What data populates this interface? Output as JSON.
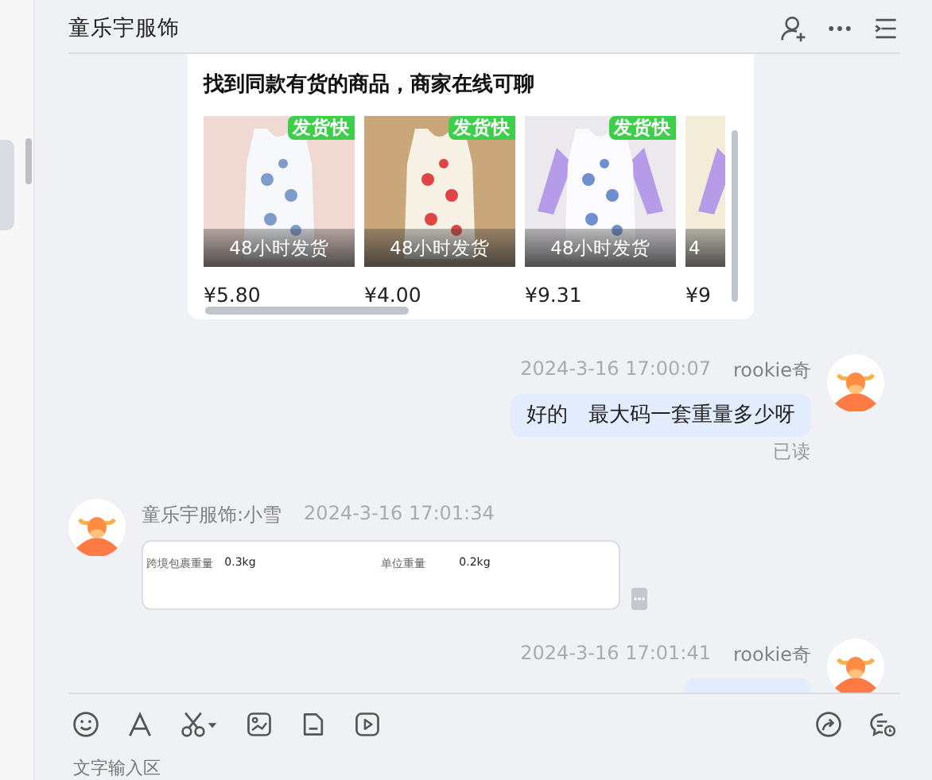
{
  "header": {
    "title": "童乐宇服饰"
  },
  "product_card": {
    "title": "找到同款有货的商品，商家在线可聊",
    "products": [
      {
        "badge": "发货快",
        "overlay": "48小时发货",
        "price": "¥5.80"
      },
      {
        "badge": "发货快",
        "overlay": "48小时发货",
        "price": "¥4.00"
      },
      {
        "badge": "发货快",
        "overlay": "48小时发货",
        "price": "¥9.31"
      },
      {
        "overlay": "4",
        "price": "¥9"
      }
    ]
  },
  "messages": [
    {
      "outgoing": true,
      "kind": "text",
      "time": "2024-3-16 17:00:07",
      "sender": "rookie奇",
      "text": "好的　最大码一套重量多少呀",
      "status": "已读"
    },
    {
      "outgoing": false,
      "kind": "table",
      "sender": "童乐宇服饰:小雪",
      "time": "2024-3-16 17:01:34",
      "cells": [
        "跨境包裹重量",
        "0.3kg",
        "单位重量",
        "0.2kg"
      ]
    },
    {
      "outgoing": true,
      "kind": "peek",
      "time": "2024-3-16 17:01:41",
      "sender": "rookie奇"
    }
  ],
  "input": {
    "placeholder": "文字输入区"
  }
}
